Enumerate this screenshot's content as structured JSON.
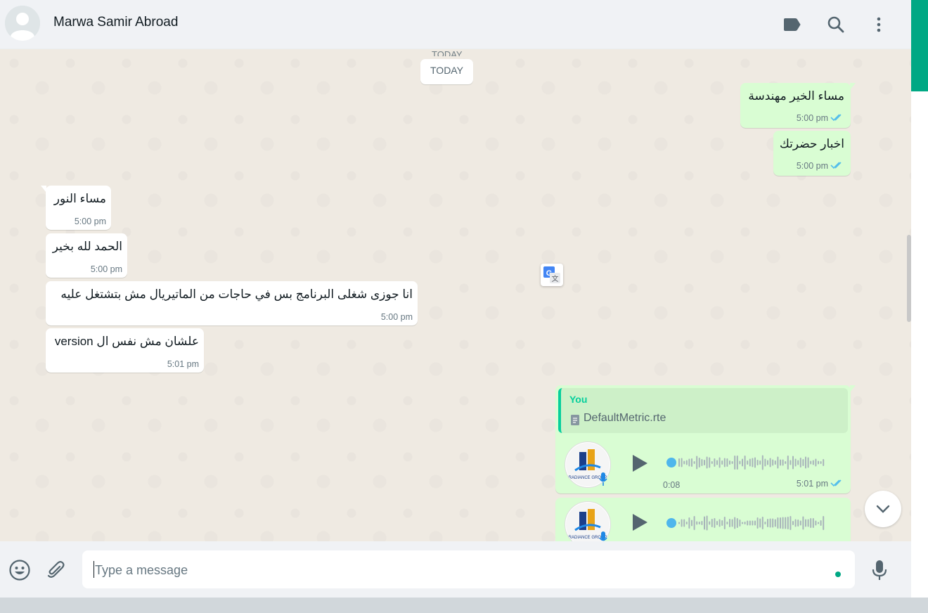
{
  "header": {
    "contact_name": "Marwa Samir Abroad",
    "icons": [
      "label-icon",
      "search-icon",
      "menu-icon"
    ]
  },
  "chat": {
    "date_ghost": "TODAY",
    "date_chip": "TODAY",
    "messages": [
      {
        "direction": "out",
        "text": "مساء الخير مهندسة",
        "time": "5:00 pm",
        "status": "read"
      },
      {
        "direction": "out",
        "text": "اخبار حضرتك",
        "time": "5:00 pm",
        "status": "read"
      },
      {
        "direction": "in",
        "text": "مساء النور",
        "time": "5:00 pm"
      },
      {
        "direction": "in",
        "text": "الحمد لله بخير",
        "time": "5:00 pm"
      },
      {
        "direction": "in",
        "text": "انا جوزى شغلى البرنامج بس في حاجات من الماتيريال مش بتشتغل عليه",
        "time": "5:00 pm"
      },
      {
        "direction": "in",
        "text": "علشان مش نفس ال version",
        "time": "5:01 pm"
      }
    ],
    "voice_reply": {
      "quote_author": "You",
      "quote_file": "DefaultMetric.rte",
      "duration": "0:08",
      "time": "5:01 pm",
      "status": "read",
      "avatar_text": "RADIANCE GROUP"
    },
    "voice_second": {
      "avatar_text": "RADIANCE GROUP"
    }
  },
  "footer": {
    "placeholder": "Type a message",
    "icons": [
      "emoji-icon",
      "attach-icon",
      "mic-icon"
    ]
  },
  "colors": {
    "outgoing_bubble": "#d9fdd3",
    "incoming_bubble": "#ffffff",
    "accent": "#00a884",
    "ticks": "#53bdeb"
  }
}
